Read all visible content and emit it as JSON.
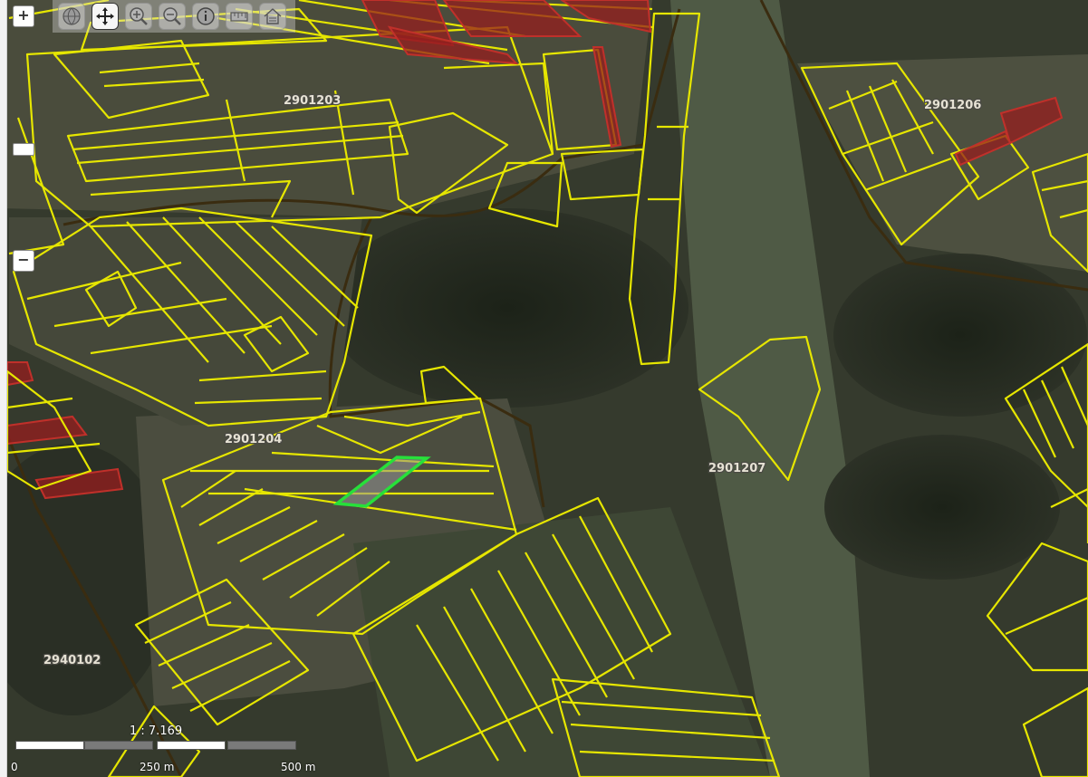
{
  "map": {
    "parcel_labels": [
      "2901203",
      "2901206",
      "2901204",
      "2901207",
      "2940102"
    ],
    "colors": {
      "parcel_outline": "#e6e600",
      "restricted_parcel": "#c0302a",
      "selected_parcel": "#27e03a",
      "cadastral_border": "#3a2c10"
    }
  },
  "toolbar": {
    "tools": [
      "globe-icon",
      "pan-icon",
      "zoom-in-icon",
      "zoom-out-icon",
      "info-icon",
      "measure-icon",
      "home-icon"
    ],
    "active_tool": "pan-icon"
  },
  "zoom": {
    "plus": "+",
    "minus": "−"
  },
  "scale": {
    "ratio": "1 : 7.169",
    "ticks": [
      "0",
      "250 m",
      "500 m"
    ]
  }
}
